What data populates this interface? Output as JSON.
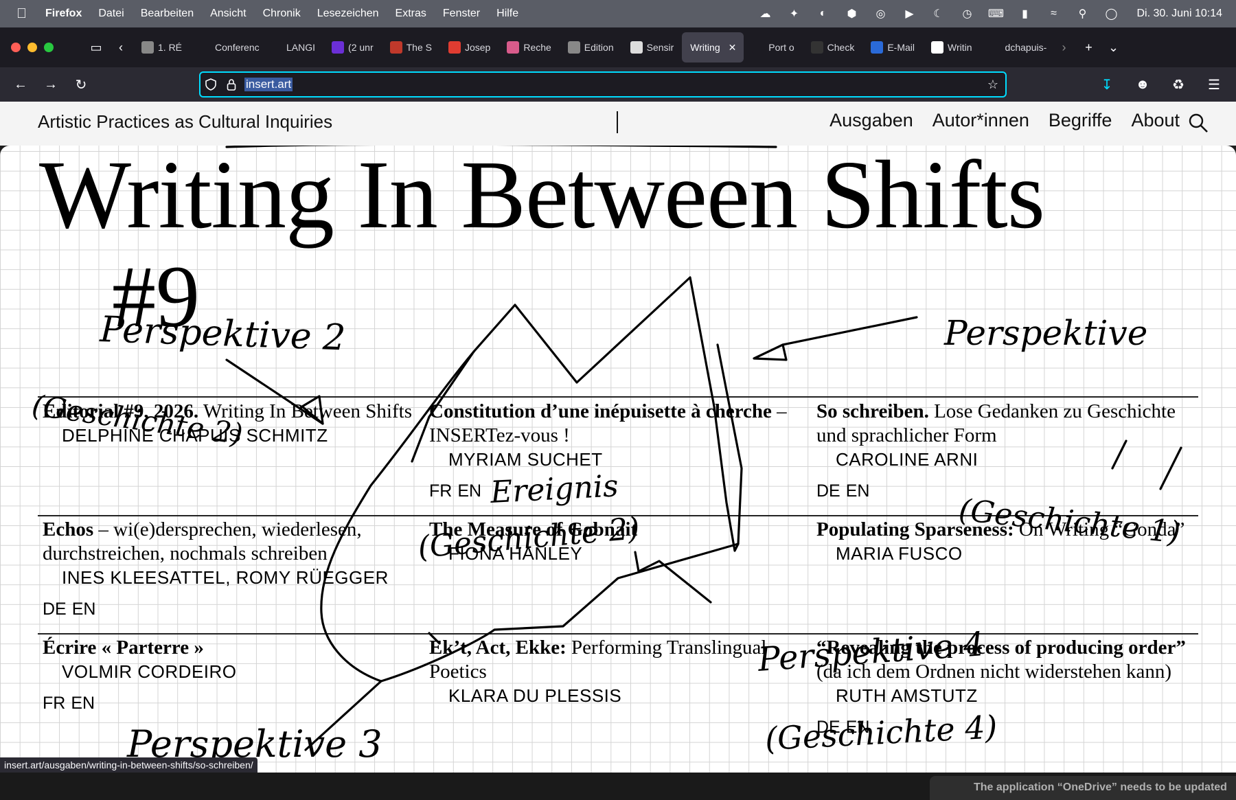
{
  "menubar": {
    "app": "Firefox",
    "items": [
      "Datei",
      "Bearbeiten",
      "Ansicht",
      "Chronik",
      "Lesezeichen",
      "Extras",
      "Fenster",
      "Hilfe"
    ],
    "clock": "Di. 30. Juni  10:14"
  },
  "tabs": [
    {
      "label": "1. RÉ",
      "color": "#888888"
    },
    {
      "label": "Conferenc",
      "color": "#1c1b22"
    },
    {
      "label": "LANGI",
      "color": "#1c1b22"
    },
    {
      "label": "(2 unr",
      "color": "#6b2fd6"
    },
    {
      "label": "The S",
      "color": "#c0392b"
    },
    {
      "label": "Josep",
      "color": "#e03c31"
    },
    {
      "label": "Reche",
      "color": "#d85b8b"
    },
    {
      "label": "Edition",
      "color": "#888888"
    },
    {
      "label": "Sensir",
      "color": "#dddddd"
    },
    {
      "label": "Writing",
      "color": "",
      "active": true
    },
    {
      "label": "Port o",
      "color": "#1c1b22"
    },
    {
      "label": "Check",
      "color": "#333333"
    },
    {
      "label": "E-Mail",
      "color": "#2a6ad8"
    },
    {
      "label": "Writin",
      "color": "#ffffff"
    },
    {
      "label": "dchapuis-",
      "color": "#1c1b22"
    }
  ],
  "navbar": {
    "url": "insert.art"
  },
  "site": {
    "title": "Artistic Practices as Cultural Inquiries",
    "nav": [
      "Ausgaben",
      "Autor*innen",
      "Begriffe",
      "About"
    ],
    "headline": "Writing In Between Shifts",
    "issue": "#9"
  },
  "articles": [
    {
      "title": "Editorial #9, 2026.",
      "rest": " Writing In Between Shifts",
      "authors": "DELPHINE CHAPUIS SCHMITZ",
      "langs": []
    },
    {
      "title": "Constitution d’une inépuisette à cherche",
      "rest": " – INSERTez-vous !",
      "authors": "MYRIAM SUCHET",
      "langs": [
        "FR",
        "EN"
      ]
    },
    {
      "title": "So schreiben.",
      "rest": " Lose Gedanken zu Geschichte und sprachlicher Form",
      "authors": "CAROLINE ARNI",
      "langs": [
        "DE",
        "EN"
      ]
    },
    {
      "title": "Echos",
      "rest": " – wi(e)dersprechen, wiederlesen, durchstreichen, nochmals schreiben",
      "authors": "INES KLEESATTEL,  ROMY RÜEGGER",
      "langs": [
        "DE",
        "EN"
      ]
    },
    {
      "title": "The Measure of Gobnait",
      "rest": "",
      "authors": "FIONA HANLEY",
      "langs": []
    },
    {
      "title": "Populating Sparseness:",
      "rest": " On Writing “Gonda”",
      "authors": "MARIA FUSCO",
      "langs": []
    },
    {
      "title": "Écrire « Parterre »",
      "rest": "",
      "authors": "VOLMIR CORDEIRO",
      "langs": [
        "FR",
        "EN"
      ]
    },
    {
      "title": "Ek’t, Act, Ekke:",
      "rest": " Performing Translingual Poetics",
      "authors": "KLARA DU PLESSIS",
      "langs": []
    },
    {
      "title": "“Revealing the process of producing order”",
      "rest": " (da ich dem Ordnen nicht widerstehen kann)",
      "authors": "RUTH AMSTUTZ",
      "langs": [
        "DE",
        "EN"
      ]
    }
  ],
  "handwriting": {
    "p1": "Perspektive 2",
    "p2": "Perspektive",
    "p3": "Perspektive 3",
    "p4": "Perspektive 4",
    "g1": "(Geschichte 2)",
    "g2": "Ereignis",
    "g3": "(Geschichte 2)",
    "g4": "(Geschichte 1)",
    "g5": "(Geschichte 4)"
  },
  "status_link": "insert.art/ausgaben/writing-in-between-shifts/so-schreiben/",
  "notification": "The application “OneDrive” needs to be updated"
}
